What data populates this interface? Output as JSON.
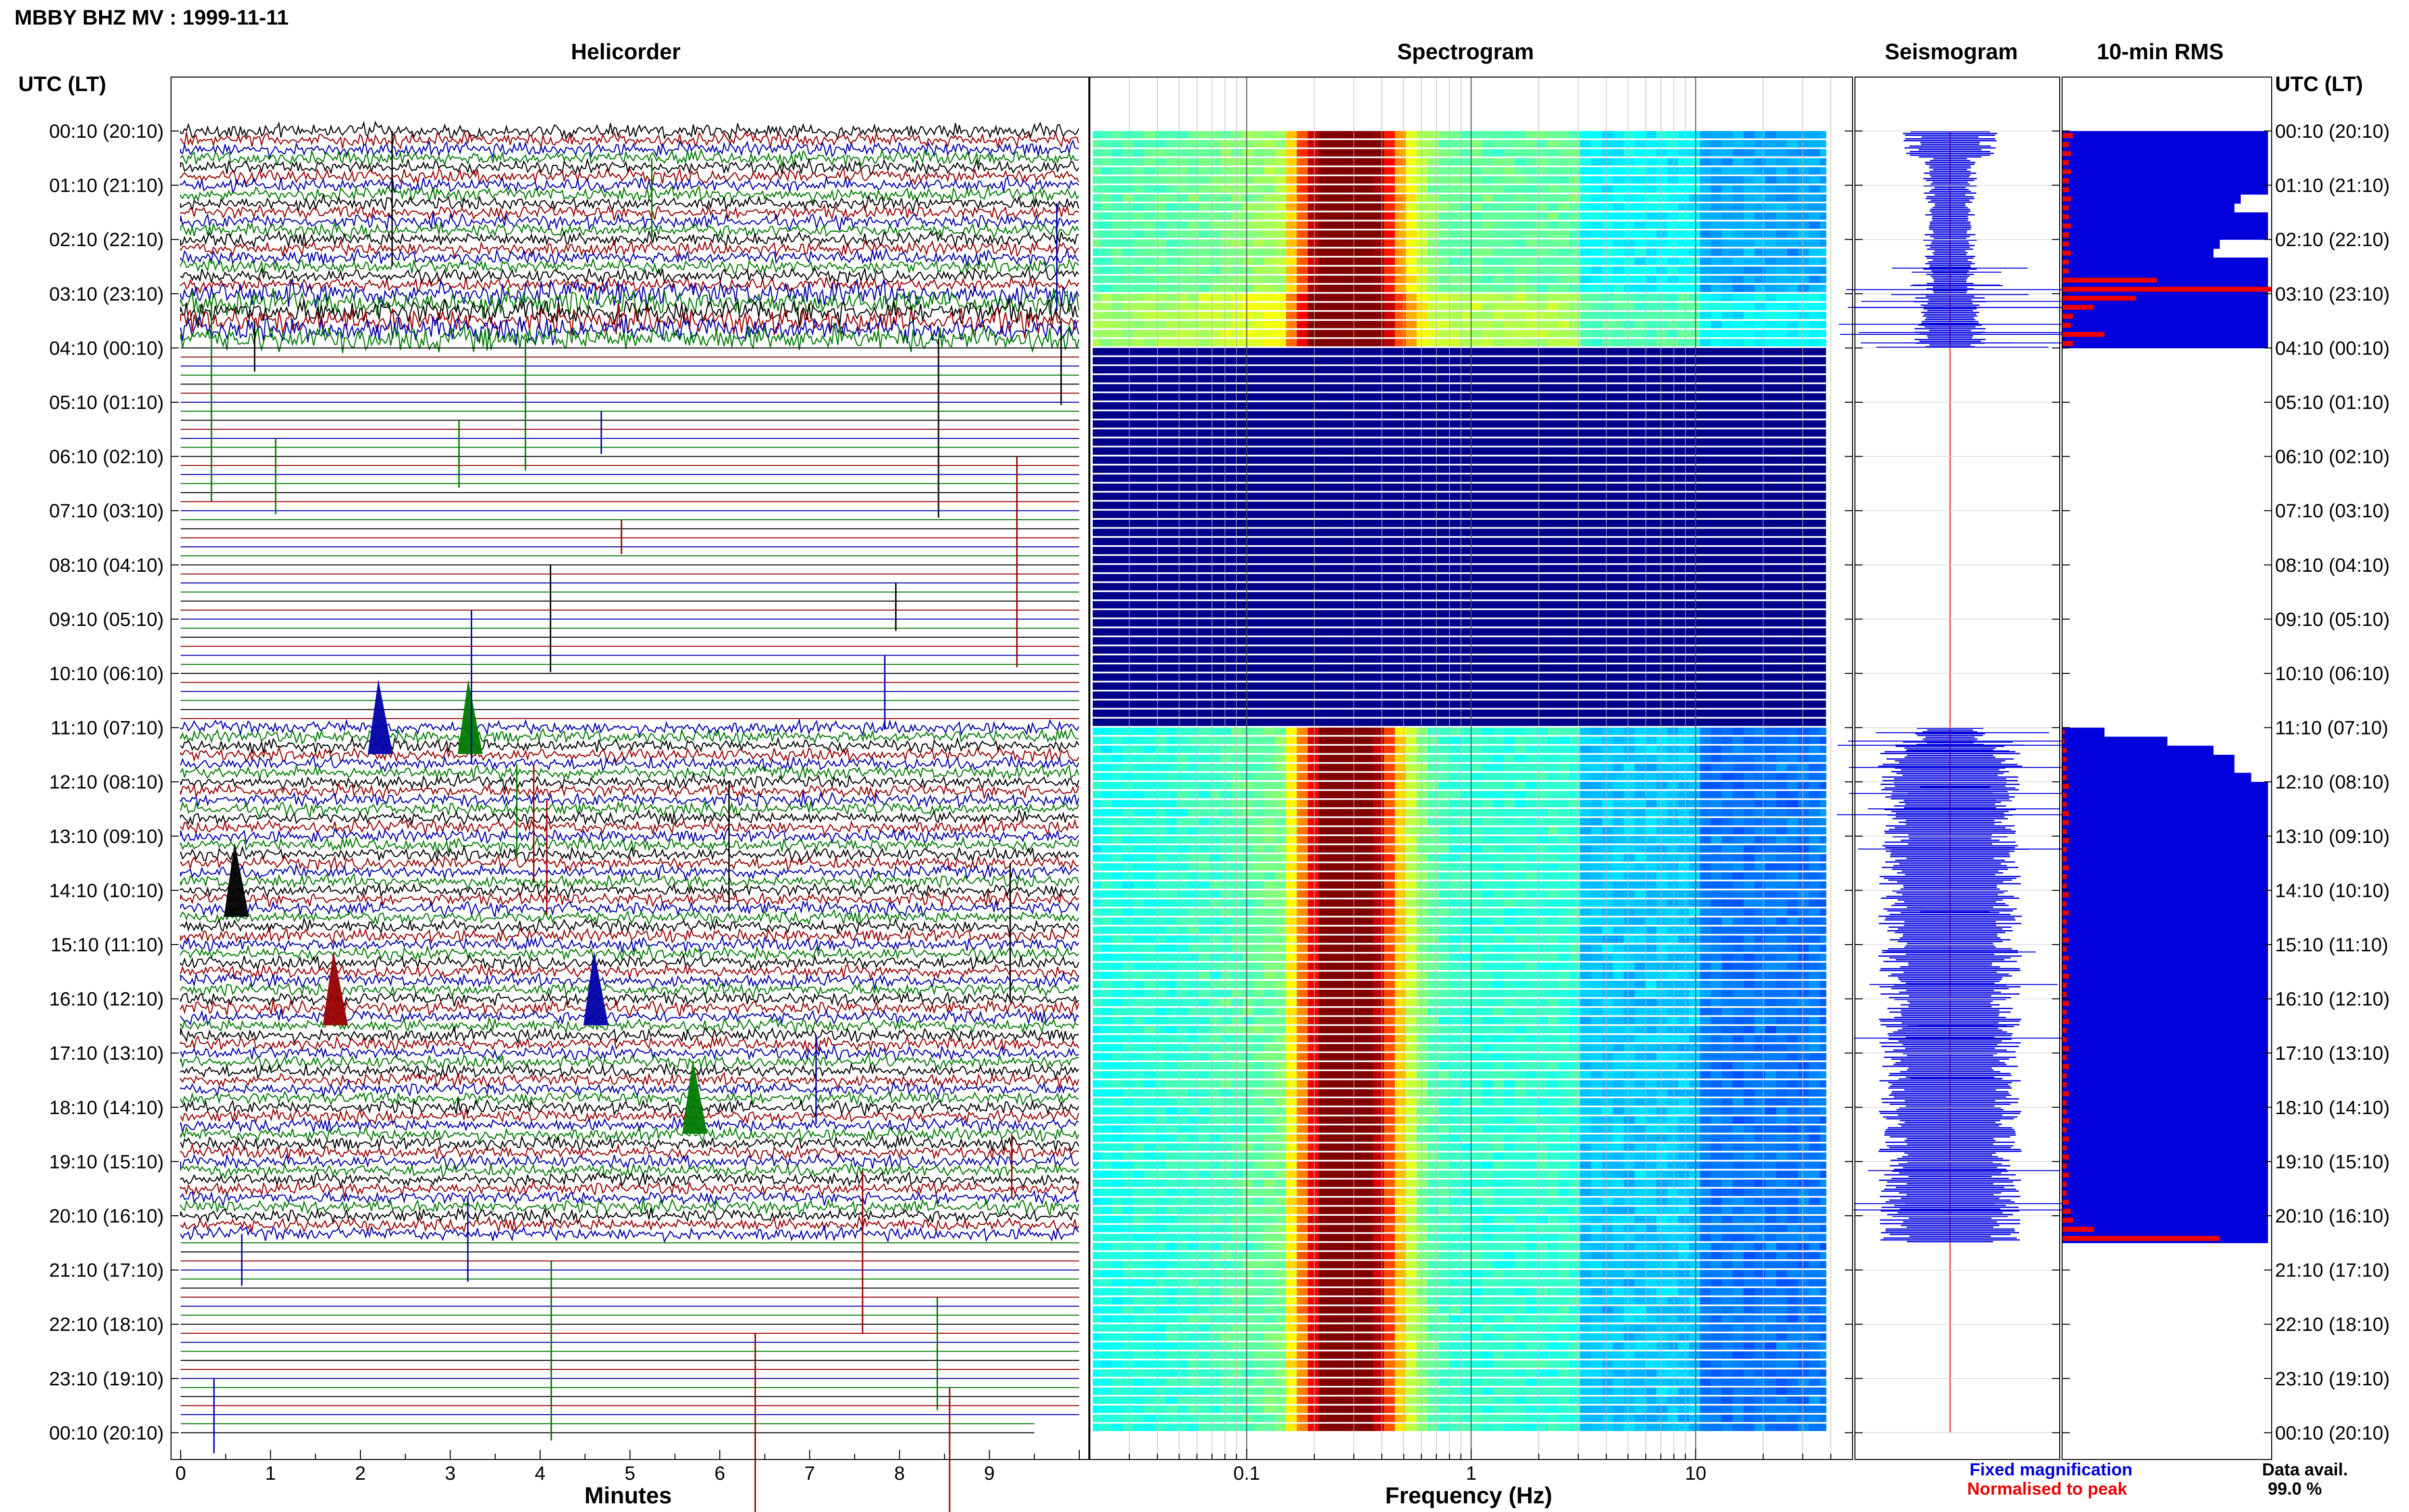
{
  "title": "MBBY BHZ MV : 1999-11-11",
  "panels": {
    "helicorder": "Helicorder",
    "spectrogram": "Spectrogram",
    "seismogram": "Seismogram",
    "rms": "10-min RMS"
  },
  "axis": {
    "left_header": "UTC (LT)",
    "right_header": "UTC (LT)",
    "row_labels": [
      "00:10 (20:10)",
      "01:10 (21:10)",
      "02:10 (22:10)",
      "03:10 (23:10)",
      "04:10 (00:10)",
      "05:10 (01:10)",
      "06:10 (02:10)",
      "07:10 (03:10)",
      "08:10 (04:10)",
      "09:10 (05:10)",
      "10:10 (06:10)",
      "11:10 (07:10)",
      "12:10 (08:10)",
      "13:10 (09:10)",
      "14:10 (10:10)",
      "15:10 (11:10)",
      "16:10 (12:10)",
      "17:10 (13:10)",
      "18:10 (14:10)",
      "19:10 (15:10)",
      "20:10 (16:10)",
      "21:10 (17:10)",
      "22:10 (18:10)",
      "23:10 (19:10)",
      "00:10 (20:10)"
    ],
    "minutes_label": "Minutes",
    "minutes_ticks": [
      "0",
      "1",
      "2",
      "3",
      "4",
      "5",
      "6",
      "7",
      "8",
      "9"
    ],
    "frequency_label": "Frequency (Hz)",
    "frequency_ticks": [
      "0.1",
      "1",
      "10"
    ]
  },
  "legend": {
    "fixed": "Fixed magnification",
    "normalised": "Normalised to peak",
    "fixed_color": "#0000dd",
    "normalised_color": "#ee0000"
  },
  "data_avail": {
    "label": "Data avail.",
    "value": "99.0 %"
  },
  "chart_data": [
    {
      "type": "heatmap",
      "title": "Helicorder",
      "xlabel": "Minutes",
      "xlim": [
        0,
        10
      ],
      "trace_colors": [
        "#000000",
        "#990000",
        "#0000aa",
        "#007a00"
      ],
      "active_periods_utc": [
        [
          "00:10",
          "04:10"
        ],
        [
          "11:10",
          "20:40"
        ]
      ],
      "notable_events_hour_minute": [
        [
          "11:10",
          2.2
        ],
        [
          "11:10",
          3.2
        ],
        [
          "14:10",
          0.6
        ],
        [
          "16:10",
          1.7
        ],
        [
          "16:10",
          4.6
        ],
        [
          "18:10",
          5.7
        ]
      ]
    },
    {
      "type": "heatmap",
      "title": "Spectrogram",
      "xlabel": "Frequency (Hz)",
      "x_scale": "log",
      "xlim": [
        0.02,
        50
      ],
      "peak_frequency_band_hz": [
        0.2,
        0.4
      ],
      "no_data_periods_utc": [
        [
          "04:10",
          "11:10"
        ],
        [
          "20:40",
          "00:10"
        ]
      ]
    },
    {
      "type": "area",
      "title": "Seismogram",
      "colors": {
        "fixed": "#0000dd",
        "normalised": "#ee0000"
      }
    },
    {
      "type": "bar",
      "title": "10-min RMS",
      "series": [
        {
          "name": "Fixed magnification",
          "color": "#0000dd",
          "segments": [
            {
              "start": "00:10",
              "values": [
                0.98,
                0.98,
                0.98,
                0.98,
                0.98,
                0.98,
                0.98,
                0.85,
                0.82,
                0.98,
                0.98,
                0.98,
                0.75,
                0.72,
                0.98,
                0.98,
                0.98,
                0.98,
                0.98,
                0.98,
                0.98,
                0.98,
                0.98,
                0.98
              ]
            },
            {
              "start": "11:10",
              "values": [
                0.2,
                0.5,
                0.72,
                0.82,
                0.82,
                0.9,
                0.98,
                0.98,
                0.98,
                0.98,
                0.98,
                0.98,
                0.98,
                0.98,
                0.98,
                0.98,
                0.98,
                0.98,
                0.98,
                0.98,
                0.98,
                0.98,
                0.98,
                0.98,
                0.98,
                0.98,
                0.98,
                0.98,
                0.98,
                0.98,
                0.98,
                0.98,
                0.98,
                0.98,
                0.98,
                0.98,
                0.98,
                0.98,
                0.98,
                0.98,
                0.98,
                0.98,
                0.98,
                0.98,
                0.98,
                0.98,
                0.98,
                0.98,
                0.98,
                0.98,
                0.98,
                0.98,
                0.98,
                0.98,
                0.98,
                0.98,
                0.98
              ]
            }
          ]
        },
        {
          "name": "Normalised to peak",
          "color": "#ee0000",
          "segments": [
            {
              "start": "00:10",
              "values": [
                0.05,
                0.03,
                0.04,
                0.03,
                0.04,
                0.03,
                0.03,
                0.04,
                0.03,
                0.03,
                0.04,
                0.03,
                0.03,
                0.04,
                0.03,
                0.03,
                0.45,
                1.0,
                0.35,
                0.15,
                0.05,
                0.04,
                0.2,
                0.05
              ]
            },
            {
              "start": "11:10",
              "values": [
                0.01,
                0.01,
                0.02,
                0.02,
                0.02,
                0.02,
                0.03,
                0.02,
                0.02,
                0.03,
                0.03,
                0.02,
                0.03,
                0.02,
                0.02,
                0.03,
                0.02,
                0.02,
                0.03,
                0.02,
                0.03,
                0.02,
                0.02,
                0.03,
                0.02,
                0.03,
                0.02,
                0.03,
                0.02,
                0.02,
                0.03,
                0.02,
                0.03,
                0.02,
                0.02,
                0.03,
                0.02,
                0.03,
                0.02,
                0.02,
                0.03,
                0.02,
                0.02,
                0.03,
                0.02,
                0.03,
                0.02,
                0.03,
                0.02,
                0.03,
                0.02,
                0.02,
                0.03,
                0.04,
                0.05,
                0.15,
                0.75
              ]
            }
          ]
        }
      ]
    }
  ]
}
